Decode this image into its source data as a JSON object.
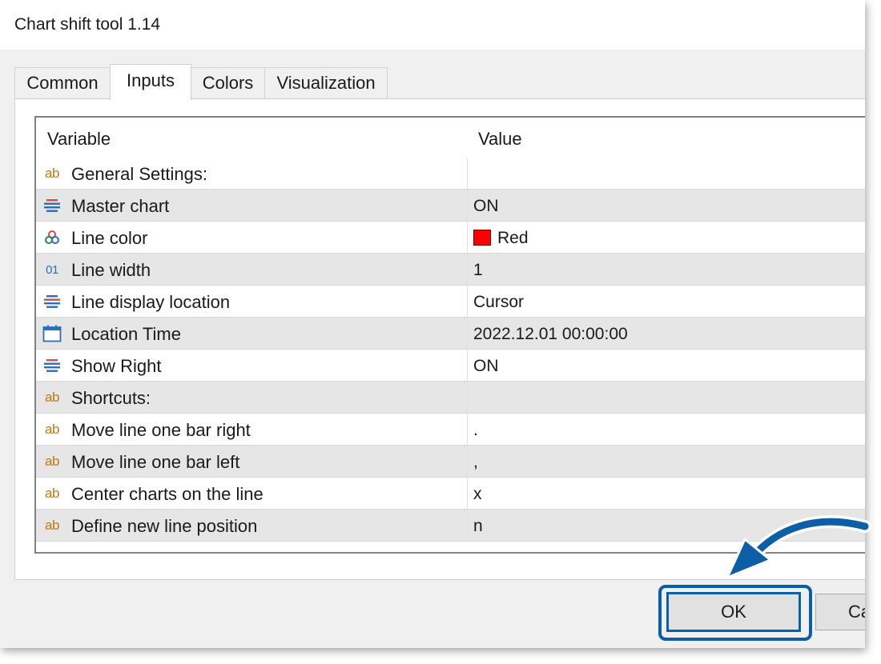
{
  "window": {
    "title": "Chart shift tool 1.14"
  },
  "tabs": [
    {
      "label": "Common"
    },
    {
      "label": "Inputs",
      "active": true
    },
    {
      "label": "Colors"
    },
    {
      "label": "Visualization"
    }
  ],
  "grid": {
    "columns": {
      "variable": "Variable",
      "value": "Value"
    },
    "rows": [
      {
        "icon": "ab-text-icon",
        "icon_text": "ab",
        "name": "General Settings:",
        "value": ""
      },
      {
        "icon": "list-enum-icon",
        "name": "Master chart",
        "value": "ON"
      },
      {
        "icon": "color-palette-icon",
        "name": "Line color",
        "value": "Red",
        "swatch": "#ff0000"
      },
      {
        "icon": "integer-icon",
        "icon_text": "01",
        "name": "Line width",
        "value": "1"
      },
      {
        "icon": "list-enum-icon",
        "name": "Line display location",
        "value": "Cursor"
      },
      {
        "icon": "calendar-icon",
        "name": "Location Time",
        "value": "2022.12.01 00:00:00"
      },
      {
        "icon": "list-enum-icon",
        "name": "Show Right",
        "value": "ON"
      },
      {
        "icon": "ab-text-icon",
        "icon_text": "ab",
        "name": "Shortcuts:",
        "value": ""
      },
      {
        "icon": "ab-text-icon",
        "icon_text": "ab",
        "name": "Move line one bar right",
        "value": "."
      },
      {
        "icon": "ab-text-icon",
        "icon_text": "ab",
        "name": "Move line one bar left",
        "value": ","
      },
      {
        "icon": "ab-text-icon",
        "icon_text": "ab",
        "name": "Center charts on the line",
        "value": "x"
      },
      {
        "icon": "ab-text-icon",
        "icon_text": "ab",
        "name": "Define new line position",
        "value": "n"
      }
    ]
  },
  "buttons": {
    "ok": "OK",
    "cancel": "Ca"
  },
  "colors": {
    "highlight": "#0c5fa6",
    "alt_row": "#e6e6e6",
    "line_color_swatch": "#ff0000"
  }
}
